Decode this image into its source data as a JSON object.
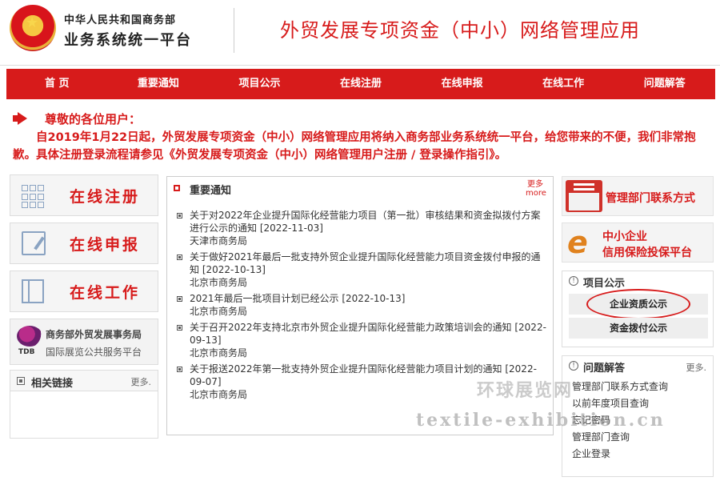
{
  "header": {
    "org_name": "中华人民共和国商务部",
    "platform_name": "业务系统统一平台",
    "app_title": "外贸发展专项资金（中小）网络管理应用"
  },
  "nav": [
    {
      "label": "首 页"
    },
    {
      "label": "重要通知"
    },
    {
      "label": "项目公示"
    },
    {
      "label": "在线注册"
    },
    {
      "label": "在线申报"
    },
    {
      "label": "在线工作"
    },
    {
      "label": "问题解答"
    }
  ],
  "notice": {
    "title": "尊敬的各位用户：",
    "body": "自2019年1月22日起，外贸发展专项资金（中小）网络管理应用将纳入商务部业务系统统一平台，给您带来的不便，我们非常抱歉。具体注册登录流程请参见《外贸发展专项资金（中小）网络管理用户注册 / 登录操作指引》。"
  },
  "left": {
    "buttons": [
      {
        "label": "在线注册",
        "icon": "grid-edit-icon"
      },
      {
        "label": "在线申报",
        "icon": "doc-edit-icon"
      },
      {
        "label": "在线工作",
        "icon": "book-icon"
      }
    ],
    "tdb": {
      "logo_text": "TDB",
      "title": "商务部外贸发展事务局",
      "subtitle": "国际展览公共服务平台"
    },
    "links": {
      "title": "相关链接",
      "more": "更多."
    }
  },
  "news": {
    "title": "重要通知",
    "more": "更多 more",
    "items": [
      {
        "title": "关于对2022年企业提升国际化经营能力项目（第一批）审核结果和资金拟拨付方案进行公示的通知 [2022-11-03]",
        "source": "天津市商务局"
      },
      {
        "title": "关于做好2021年最后一批支持外贸企业提升国际化经营能力项目资金拨付申报的通知 [2022-10-13]",
        "source": "北京市商务局"
      },
      {
        "title": "2021年最后一批项目计划已经公示 [2022-10-13]",
        "source": "北京市商务局"
      },
      {
        "title": "关于召开2022年支持北京市外贸企业提升国际化经营能力政策培训会的通知 [2022-09-13]",
        "source": "北京市商务局"
      },
      {
        "title": "关于报送2022年第一批支持外贸企业提升国际化经营能力项目计划的通知 [2022-09-07]",
        "source": "北京市商务局"
      }
    ]
  },
  "right": {
    "contact_label": "管理部门联系方式",
    "insurance_line1": "中小企业",
    "insurance_line2": "信用保险投保平台",
    "insurance_logo": "e",
    "projects": {
      "title": "项目公示",
      "items": [
        "企业资质公示",
        "资金拨付公示"
      ]
    },
    "faq": {
      "title": "问题解答",
      "more": "更多.",
      "items": [
        "管理部门联系方式查询",
        "以前年度项目查询",
        "忘记密码",
        "管理部门查询",
        "企业登录"
      ]
    }
  },
  "watermark": {
    "cn": "环球展览网",
    "en": "textile-exhibition.cn"
  }
}
